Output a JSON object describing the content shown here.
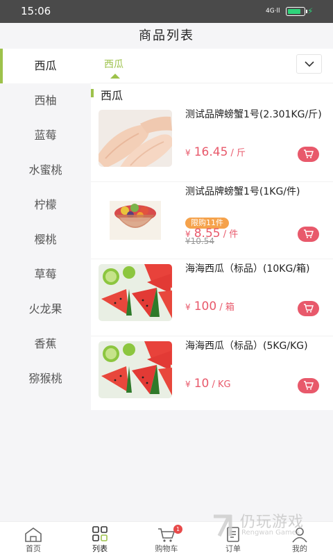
{
  "status": {
    "time": "15:06",
    "signal": "4G·ll"
  },
  "header": {
    "title": "商品列表"
  },
  "sidebar": {
    "items": [
      {
        "label": "西瓜"
      },
      {
        "label": "西柚"
      },
      {
        "label": "蓝莓"
      },
      {
        "label": "水蜜桃"
      },
      {
        "label": "柠檬"
      },
      {
        "label": "樱桃"
      },
      {
        "label": "草莓"
      },
      {
        "label": "火龙果"
      },
      {
        "label": "香蕉"
      },
      {
        "label": "猕猴桃"
      }
    ]
  },
  "tabs": {
    "active": "西瓜"
  },
  "section": {
    "title": "西瓜"
  },
  "products": [
    {
      "name": "测试品牌螃蟹1号(2.301KG/斤)",
      "yen": "¥",
      "price": "16.45",
      "unit": " / 斤",
      "image": "chicken-wings-image"
    },
    {
      "name": "测试品牌螃蟹1号(1KG/件)",
      "limit": "限购11件",
      "yen": "¥",
      "price": "8.55",
      "unit": " / 件",
      "old_price": "¥10.54",
      "image": "fruit-salad-image"
    },
    {
      "name": "海海西瓜（标品）(10KG/箱)",
      "yen": "¥",
      "price": "100",
      "unit": " / 箱",
      "image": "watermelon-image"
    },
    {
      "name": "海海西瓜（标品）(5KG/KG)",
      "yen": "¥",
      "price": "10",
      "unit": " / KG",
      "image": "watermelon-image"
    }
  ],
  "bottom_nav": [
    {
      "label": "首页",
      "icon": "home-icon"
    },
    {
      "label": "列表",
      "icon": "grid-icon"
    },
    {
      "label": "购物车",
      "icon": "cart-icon",
      "badge": "1"
    },
    {
      "label": "订单",
      "icon": "order-icon"
    },
    {
      "label": "我的",
      "icon": "profile-icon"
    }
  ],
  "watermark": {
    "name": "仍玩游戏",
    "sub": "Rengwan Games"
  },
  "colors": {
    "accent": "#9dc24b",
    "price": "#e8596b",
    "limit_badge": "#f5a24b",
    "cart_badge": "#e84a4a"
  }
}
